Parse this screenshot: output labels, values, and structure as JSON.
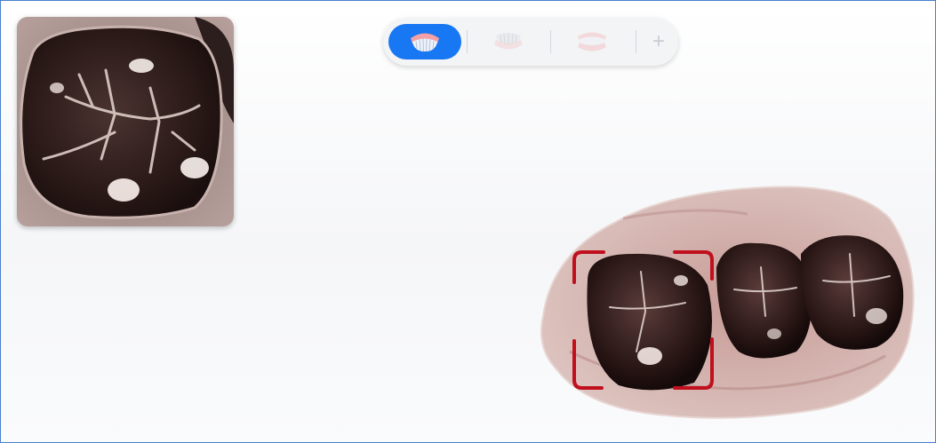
{
  "toolbar": {
    "jaw_buttons": [
      {
        "name": "upper-jaw",
        "icon": "upper-jaw-icon",
        "state": "selected"
      },
      {
        "name": "lower-jaw",
        "icon": "lower-jaw-icon",
        "state": "unselected"
      },
      {
        "name": "both-jaws",
        "icon": "both-jaws-icon",
        "state": "unselected"
      }
    ],
    "add_label": "+"
  },
  "preview": {
    "icon": "intraoral-camera-preview"
  },
  "model": {
    "icon": "3d-tooth-scan-model",
    "focus_box": "selection-frame"
  },
  "colors": {
    "accent": "#1877f2",
    "focus_frame": "#c0101e",
    "border": "#4a7fd0"
  }
}
